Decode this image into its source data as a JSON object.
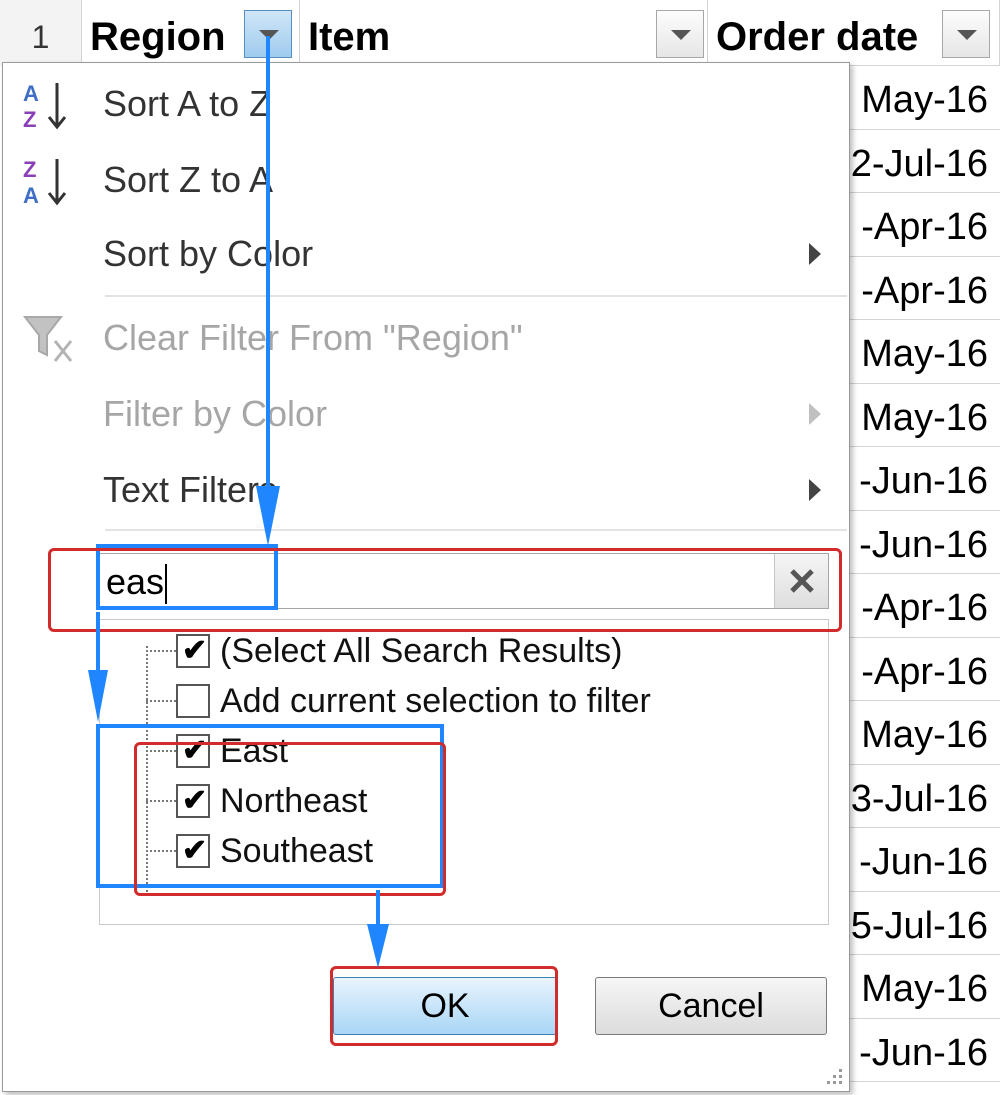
{
  "sheet": {
    "row_number": "1",
    "columns": [
      {
        "label": "Region"
      },
      {
        "label": "Item"
      },
      {
        "label": "Order date"
      }
    ],
    "visible_dates": [
      "May-16",
      "2-Jul-16",
      "-Apr-16",
      "-Apr-16",
      "May-16",
      "May-16",
      "-Jun-16",
      "-Jun-16",
      "-Apr-16",
      "-Apr-16",
      "May-16",
      "3-Jul-16",
      "-Jun-16",
      "5-Jul-16",
      "May-16",
      "-Jun-16"
    ]
  },
  "menu": {
    "items": [
      {
        "label": "Sort A to Z",
        "icon": "sort-az-icon",
        "enabled": true,
        "submenu": false
      },
      {
        "label": "Sort Z to A",
        "icon": "sort-za-icon",
        "enabled": true,
        "submenu": false
      },
      {
        "label": "Sort by Color",
        "icon": "",
        "enabled": true,
        "submenu": true
      },
      {
        "label": "Clear Filter From \"Region\"",
        "icon": "clear-filter-icon",
        "enabled": false,
        "submenu": false
      },
      {
        "label": "Filter by Color",
        "icon": "",
        "enabled": false,
        "submenu": true
      },
      {
        "label": "Text Filters",
        "icon": "",
        "enabled": true,
        "submenu": true
      }
    ],
    "search": {
      "value": "eas",
      "clear_icon": "close-icon"
    },
    "results": [
      {
        "label": "(Select All Search Results)",
        "checked": true
      },
      {
        "label": "Add current selection to filter",
        "checked": false
      },
      {
        "label": "East",
        "checked": true
      },
      {
        "label": "Northeast",
        "checked": true
      },
      {
        "label": "Southeast",
        "checked": true
      }
    ],
    "buttons": {
      "ok": "OK",
      "cancel": "Cancel"
    }
  },
  "annotation_colors": {
    "blue": "#1f86ff",
    "red": "#d12b2b"
  }
}
